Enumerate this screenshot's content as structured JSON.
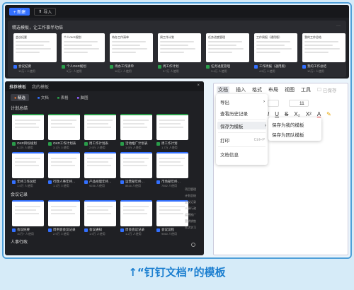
{
  "top": {
    "new_label": "+ 新建",
    "import_label": "导入",
    "templates_heading": "精选模板，让工作事半功倍",
    "more_label": "···",
    "cards": [
      {
        "title": "会议纪要",
        "caption": "会议纪要",
        "users": "10万+ 人使用",
        "color": "#3370ff"
      },
      {
        "title": "个人OKR规划",
        "caption": "个人OKR规划",
        "users": "5万+ 人使用",
        "color": "#2a9d4a"
      },
      {
        "title": "待办工作清单",
        "caption": "待办工作清单",
        "users": "10万+ 人使用",
        "color": "#2a9d4a"
      },
      {
        "title": "周工作计划",
        "caption": "周工作计划",
        "users": "3.7万 人使用",
        "color": "#2a9d4a"
      },
      {
        "title": "任务进度管理",
        "caption": "任务进度管理",
        "users": "3.4万 人使用",
        "color": "#2a9d4a"
      },
      {
        "title": "工作周报（通用版）",
        "caption": "工作周报（通用版）",
        "users": "4.5万 人使用",
        "color": "#3370ff"
      },
      {
        "title": "我的工作总结",
        "caption": "我的工作总结",
        "users": "10万+ 人使用",
        "color": "#3370ff"
      }
    ]
  },
  "left": {
    "tabs": [
      "推荐模板",
      "我的模板"
    ],
    "close": "×",
    "categories": [
      "精选",
      "文档",
      "表格",
      "脑图"
    ],
    "section_plan": "计划总结",
    "row1": [
      {
        "caption": "OKR目标规划",
        "users": "6.2万 人使用",
        "border": "green"
      },
      {
        "caption": "OKR工作计划表",
        "users": "3.1万 人使用",
        "border": "green"
      },
      {
        "caption": "周工作计划表",
        "users": "2.9万 人使用",
        "border": "green"
      },
      {
        "caption": "活动推广计划表",
        "users": "1.9万 人使用",
        "border": "green"
      },
      {
        "caption": "周工作计划",
        "users": "1.7万 人使用",
        "border": "green"
      }
    ],
    "row2": [
      {
        "caption": "年终工作总结",
        "users": "1.5万 人使用",
        "border": "blue"
      },
      {
        "caption": "行政人事年终…",
        "users": "1.1万 人使用",
        "border": "blue"
      },
      {
        "caption": "产品经理年终…",
        "users": "9236 人使用",
        "border": "blue"
      },
      {
        "caption": "运营部年终…",
        "users": "8816 人使用",
        "border": "blue"
      },
      {
        "caption": "市场部年终…",
        "users": "7552 人使用",
        "border": "blue"
      }
    ],
    "section_meeting": "会议记录",
    "row3": [
      {
        "caption": "会议纪要",
        "users": "10万+ 人使用",
        "border": "blue"
      },
      {
        "caption": "周例会会议记录",
        "users": "2.9万 人使用",
        "border": "blue"
      },
      {
        "caption": "会议通知",
        "users": "1.9万 人使用",
        "border": "blue"
      },
      {
        "caption": "周会会议记录",
        "users": "1.2万 人使用",
        "border": "blue"
      },
      {
        "caption": "会议议程",
        "users": "9560 人使用",
        "border": "blue"
      }
    ],
    "section_hr": "人事行政",
    "side_links": [
      "项目管理",
      "计划总结",
      "会议记录",
      "人事行政",
      "运营推广",
      "营销销售",
      "生活学习"
    ]
  },
  "right": {
    "menubar": [
      "文档",
      "插入",
      "格式",
      "布局",
      "视图",
      "工具"
    ],
    "saved": "已保存",
    "font_size": "11",
    "fmt": [
      "I",
      "U",
      "S",
      "X₂",
      "X²",
      "A"
    ],
    "menu": [
      {
        "label": "导出",
        "arrow": "›"
      },
      {
        "label": "查看历史记录",
        "arrow": ""
      },
      {
        "label": "保存为模板",
        "arrow": "›"
      },
      {
        "label": "打印",
        "shortcut": "Ctrl+P"
      },
      {
        "label": "文档信息",
        "arrow": ""
      }
    ],
    "submenu": [
      "保存为我的模板",
      "保存为团队模板"
    ]
  },
  "caption": "↑“钉钉文档”的模板"
}
